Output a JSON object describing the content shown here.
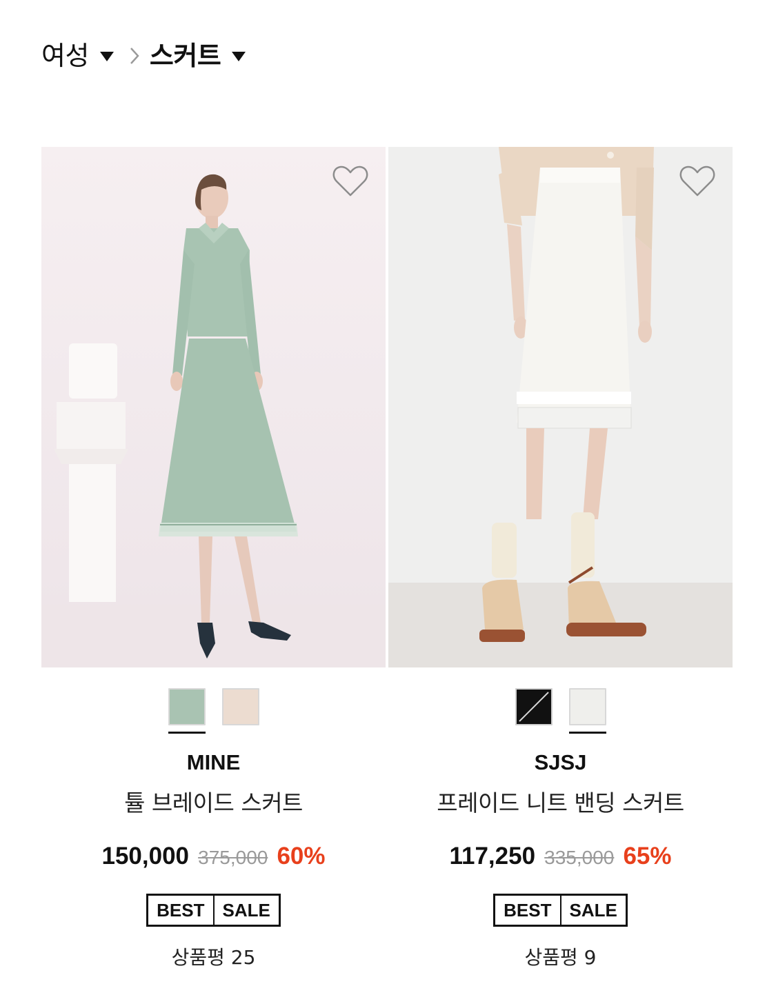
{
  "breadcrumb": {
    "parent": "여성",
    "current": "스커트"
  },
  "colors": {
    "text": "#111111",
    "discount": "#e8401c",
    "strike": "#9a9a9a"
  },
  "products": [
    {
      "brand": "MINE",
      "name": "튤 브레이드 스커트",
      "price": "150,000",
      "original_price": "375,000",
      "discount": "60%",
      "badges": [
        "BEST",
        "SALE"
      ],
      "reviews": "상품평 25",
      "swatches": [
        {
          "color": "#a9c3b2",
          "selected": true
        },
        {
          "color": "#ecdcd0",
          "selected": false
        }
      ]
    },
    {
      "brand": "SJSJ",
      "name": "프레이드 니트 밴딩 스커트",
      "price": "117,250",
      "original_price": "335,000",
      "discount": "65%",
      "badges": [
        "BEST",
        "SALE"
      ],
      "reviews": "상품평 9",
      "swatches": [
        {
          "color": "#111111",
          "selected": false
        },
        {
          "color": "#efefec",
          "selected": true
        }
      ]
    }
  ]
}
